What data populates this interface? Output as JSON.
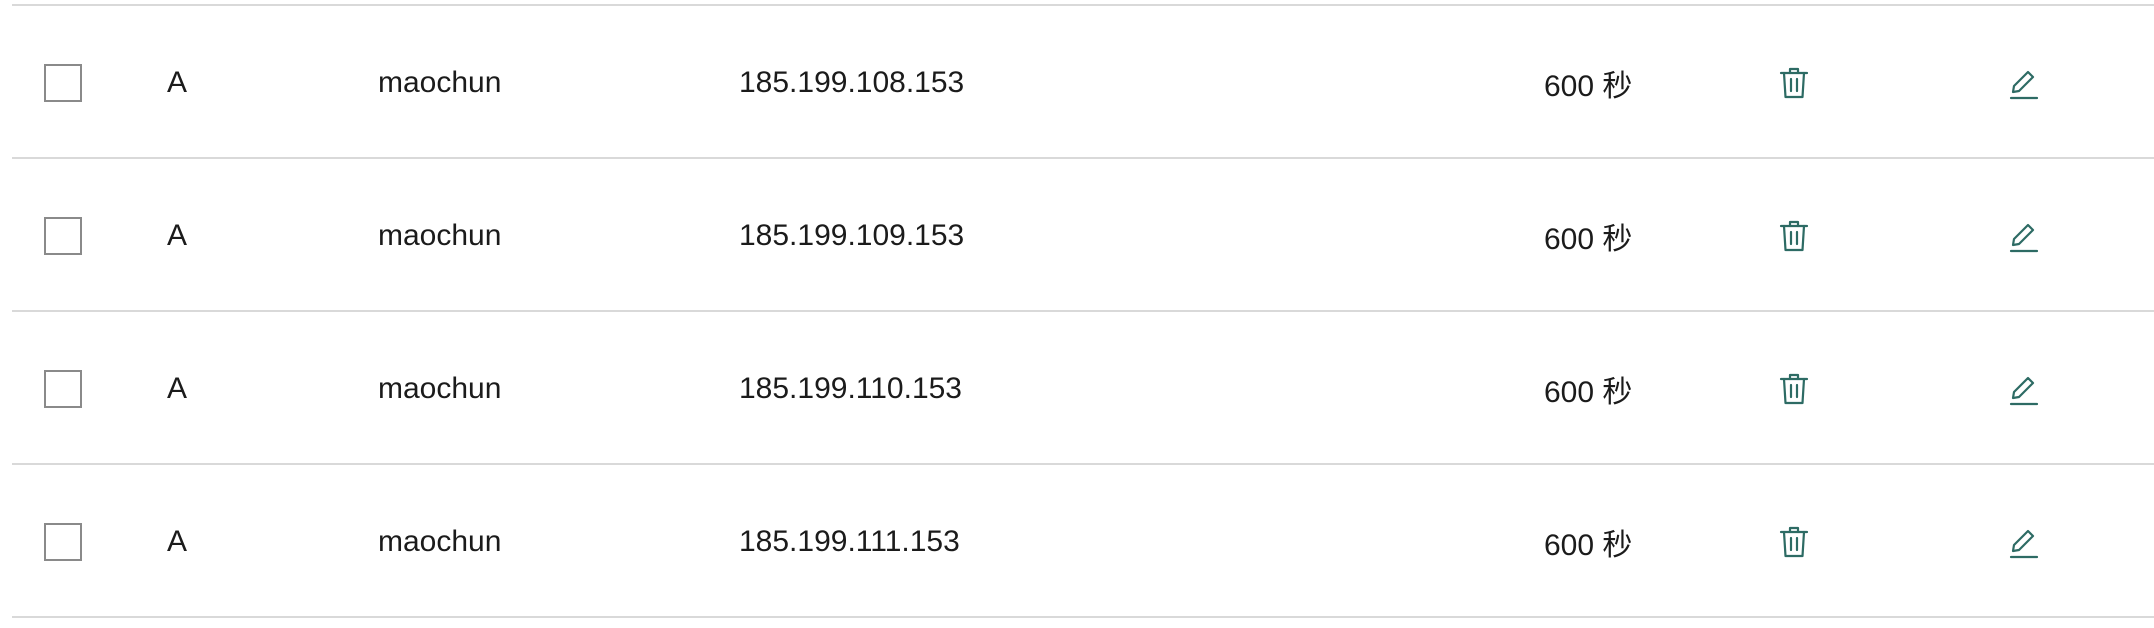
{
  "colors": {
    "icon_accent": "#2d6b64",
    "divider": "#d9d9d9",
    "text": "#1b1b1b"
  },
  "rows": [
    {
      "type": "A",
      "name": "maochun",
      "value": "185.199.108.153",
      "ttl": "600 秒",
      "delete_icon": "trash-icon",
      "edit_icon": "pencil-icon"
    },
    {
      "type": "A",
      "name": "maochun",
      "value": "185.199.109.153",
      "ttl": "600 秒",
      "delete_icon": "trash-icon",
      "edit_icon": "pencil-icon"
    },
    {
      "type": "A",
      "name": "maochun",
      "value": "185.199.110.153",
      "ttl": "600 秒",
      "delete_icon": "trash-icon",
      "edit_icon": "pencil-icon"
    },
    {
      "type": "A",
      "name": "maochun",
      "value": "185.199.111.153",
      "ttl": "600 秒",
      "delete_icon": "trash-icon",
      "edit_icon": "pencil-icon"
    }
  ]
}
